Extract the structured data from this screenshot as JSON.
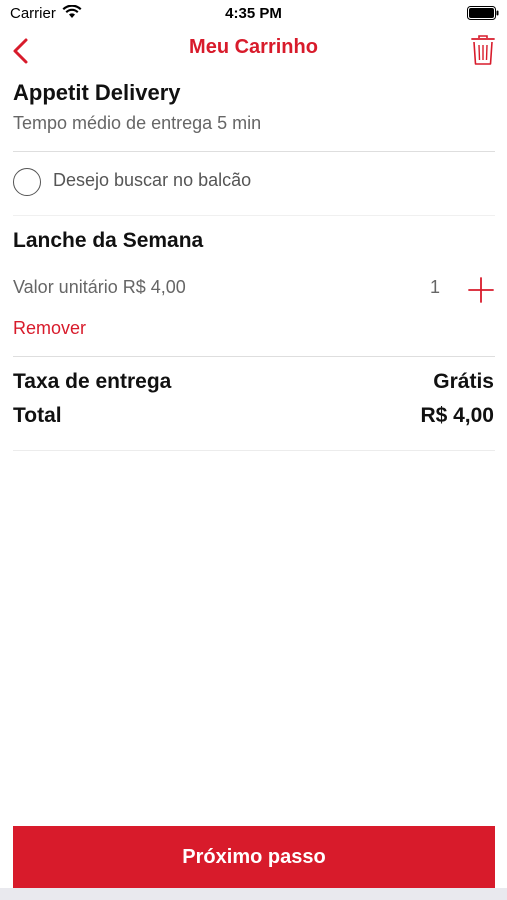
{
  "status_bar": {
    "carrier": "Carrier",
    "time": "4:35 PM",
    "wifi_icon": "wifi-icon",
    "battery_icon": "battery-icon"
  },
  "nav": {
    "title": "Meu Carrinho",
    "back_icon": "chevron-left-icon",
    "trash_icon": "trash-icon"
  },
  "store": {
    "name": "Appetit Delivery",
    "eta": "Tempo médio de entrega 5 min"
  },
  "pickup": {
    "label": "Desejo buscar no balcão",
    "checked": false
  },
  "item": {
    "name": "Lanche da Semana",
    "unit_price_label": "Valor unitário R$ 4,00",
    "quantity": "1",
    "remove_label": "Remover",
    "plus_icon": "plus-icon"
  },
  "summary": {
    "fee_label": "Taxa de entrega",
    "fee_value": "Grátis",
    "total_label": "Total",
    "total_value": "R$ 4,00"
  },
  "footer": {
    "next_label": "Próximo passo"
  },
  "colors": {
    "accent": "#d81b2b",
    "divider": "#dedede"
  }
}
